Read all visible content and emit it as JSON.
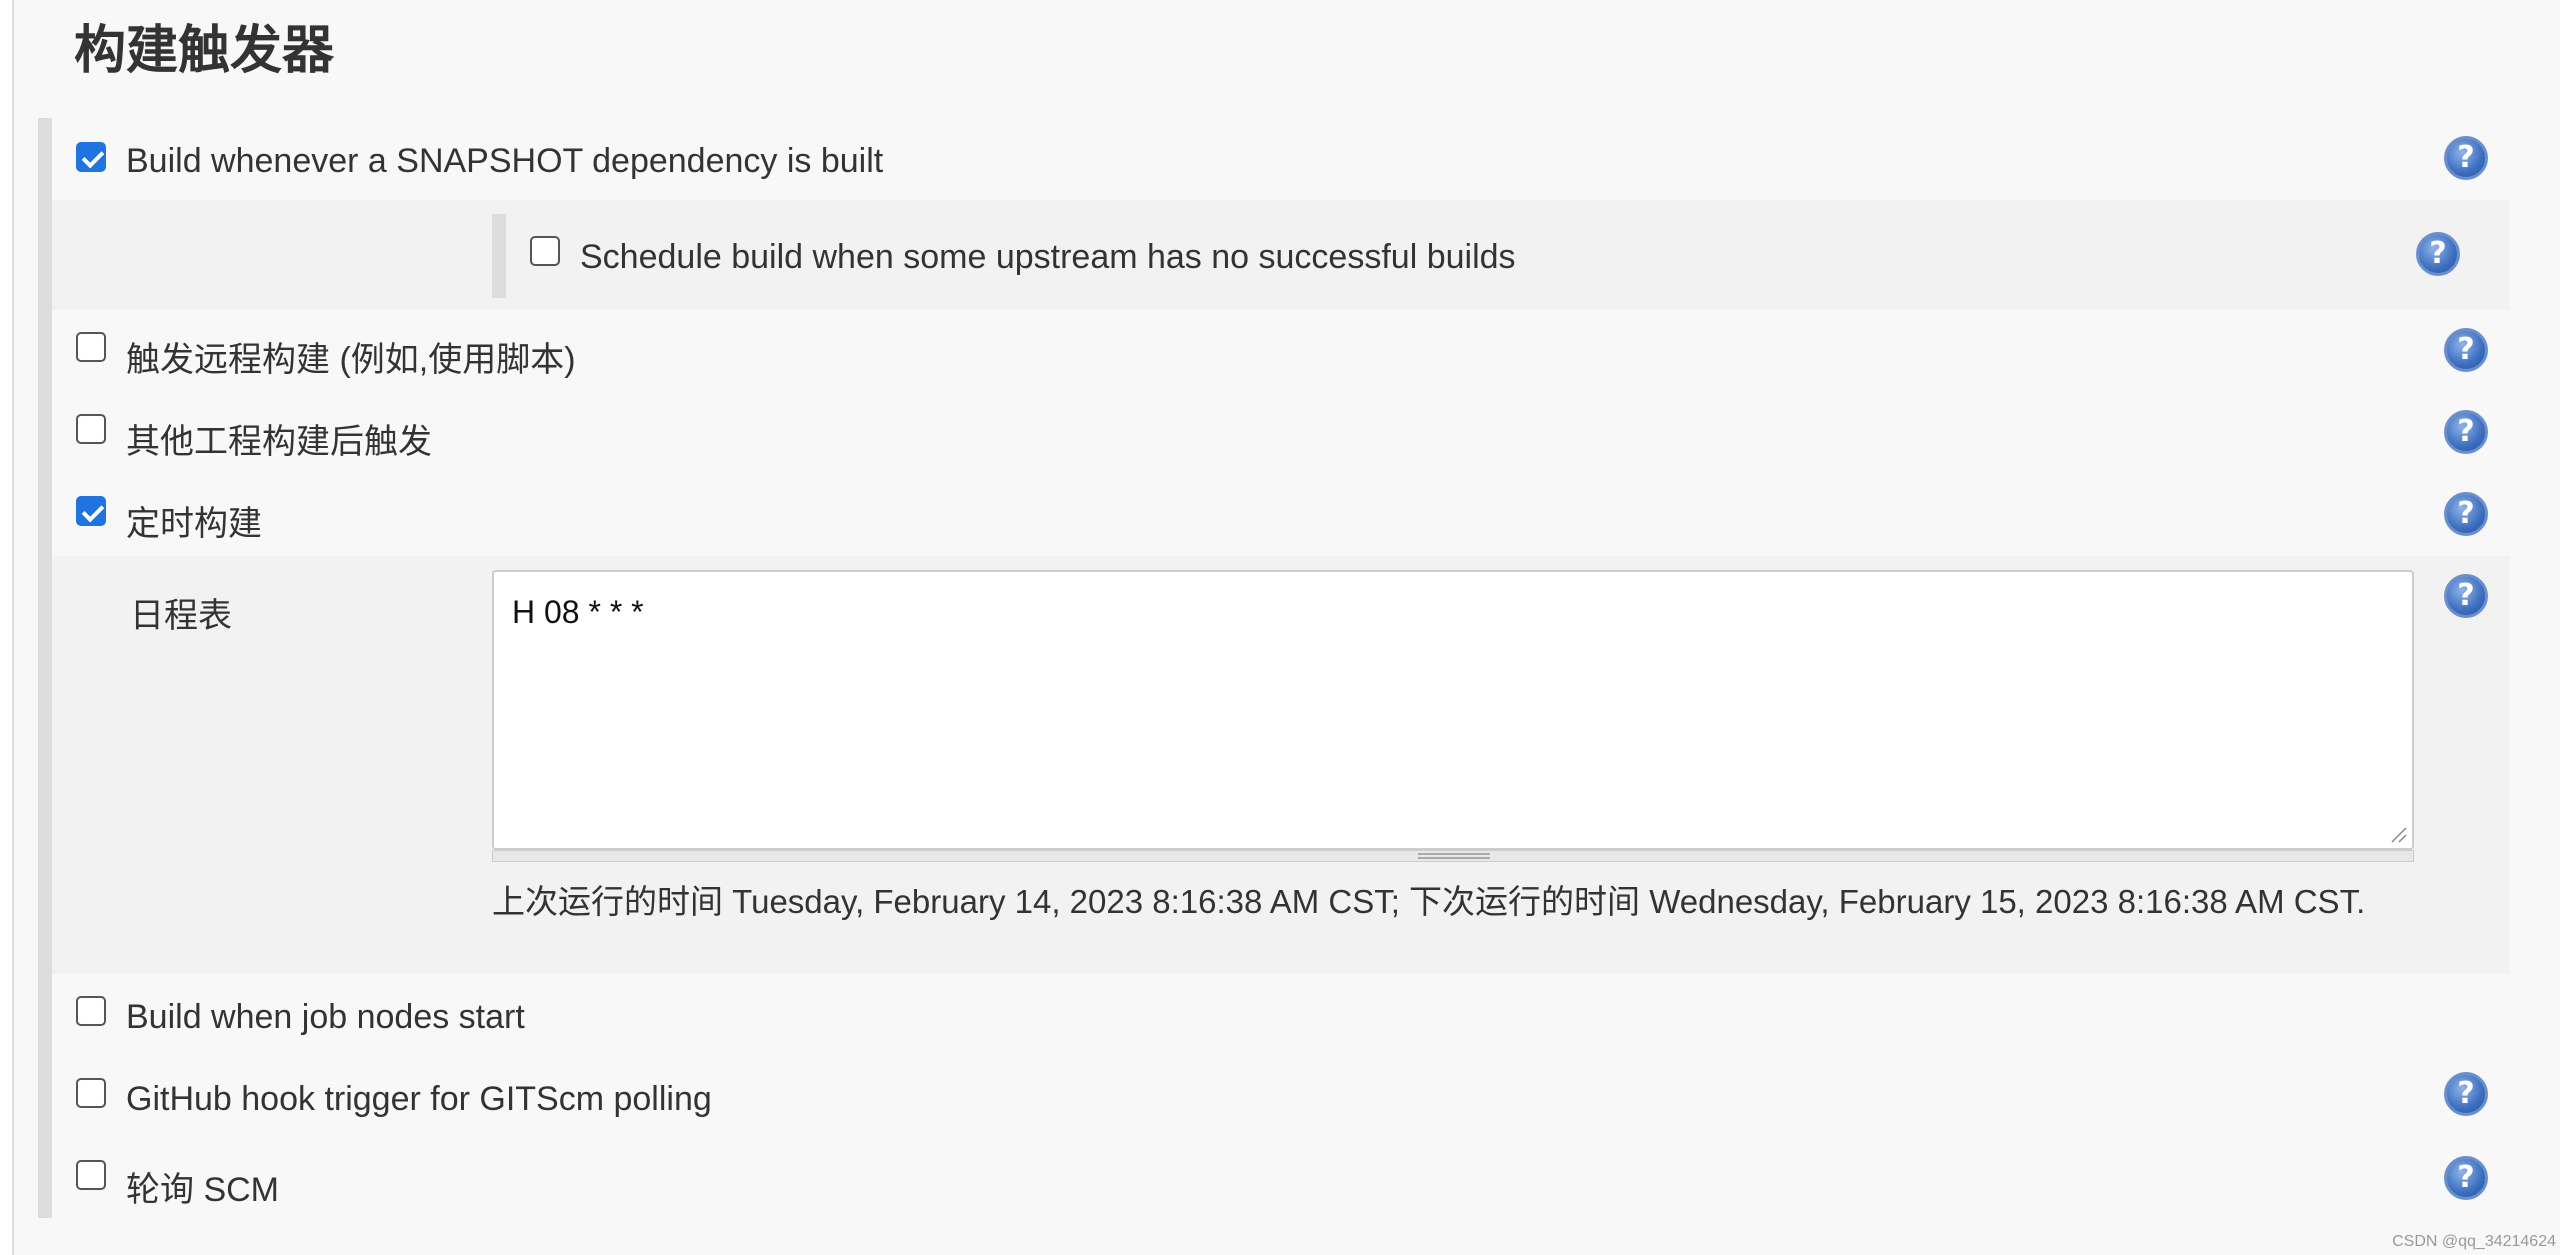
{
  "section": {
    "title": "构建触发器"
  },
  "triggers": {
    "snapshot": {
      "label": "Build whenever a SNAPSHOT dependency is built",
      "checked": true,
      "help": "?"
    },
    "upstream": {
      "label": "Schedule build when some upstream has no successful builds",
      "checked": false,
      "help": "?"
    },
    "remote": {
      "label": "触发远程构建 (例如,使用脚本)",
      "checked": false,
      "help": "?"
    },
    "after_other": {
      "label": "其他工程构建后触发",
      "checked": false,
      "help": "?"
    },
    "periodic": {
      "label": "定时构建",
      "checked": true,
      "help": "?"
    },
    "schedule": {
      "label": "日程表",
      "value": "H 08 * * *",
      "info": "上次运行的时间 Tuesday, February 14, 2023 8:16:38 AM CST; 下次运行的时间 Wednesday, February 15, 2023 8:16:38 AM CST.",
      "help": "?"
    },
    "job_nodes": {
      "label": "Build when job nodes start",
      "checked": false
    },
    "github_hook": {
      "label": "GitHub hook trigger for GITScm polling",
      "checked": false,
      "help": "?"
    },
    "poll_scm": {
      "label": "轮询 SCM",
      "checked": false,
      "help": "?"
    }
  },
  "watermark": "CSDN @qq_34214624",
  "colors": {
    "checkbox_checked": "#1f74e0",
    "help_icon": "#3d6fbf",
    "panel_bg": "#f8f8f8"
  }
}
